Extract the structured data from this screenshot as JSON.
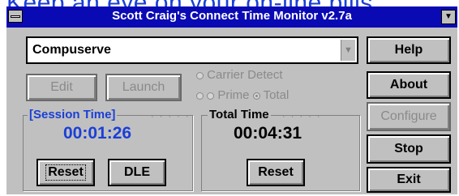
{
  "heading": "Keep an eye on your on-line bills",
  "window": {
    "title": "Scott Craig's Connect Time Monitor v2.7a",
    "sysmenu_icon": "system-menu-icon",
    "dropdown_icon": "down-arrow-icon"
  },
  "service": {
    "value": "Compuserve",
    "arrow_icon": "combo-arrow-icon"
  },
  "buttons": {
    "edit": "Edit",
    "launch": "Launch",
    "help": "Help",
    "about": "About",
    "configure": "Configure",
    "stop": "Stop",
    "exit": "Exit",
    "session_reset": "Reset",
    "dle": "DLE",
    "total_reset": "Reset"
  },
  "options": {
    "carrier_detect": "Carrier Detect",
    "prime": "Prime",
    "total": "Total",
    "selected": "Total"
  },
  "session": {
    "title": "[Session Time]",
    "time": "00:01:26",
    "color": "#1a3fd6"
  },
  "total": {
    "title": "Total Time",
    "time": "00:04:31"
  }
}
